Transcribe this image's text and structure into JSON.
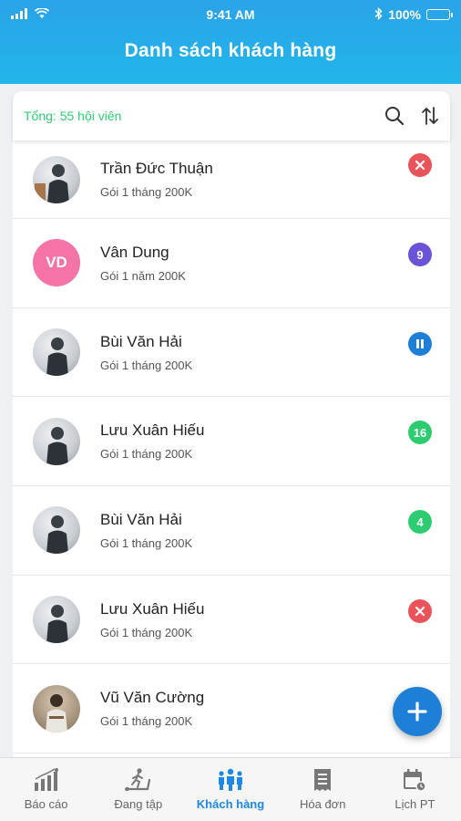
{
  "status_bar": {
    "time": "9:41 AM",
    "battery": "100%"
  },
  "header": {
    "title": "Danh sách khách hàng"
  },
  "summary": {
    "total_text": "Tổng: 55 hội viên"
  },
  "customers": [
    {
      "name": "Trần Đức Thuận",
      "plan": "Gói 1 tháng 200K",
      "avatar": "photo",
      "badge": {
        "type": "x-icon",
        "text": "",
        "color": "#e9545a"
      }
    },
    {
      "name": "Vân Dung",
      "plan": "Gói 1 năm 200K",
      "avatar": "initials",
      "initials": "VD",
      "badge": {
        "type": "number",
        "text": "9",
        "color": "#6b52d6"
      }
    },
    {
      "name": "Bùi Văn Hải",
      "plan": "Gói 1 tháng 200K",
      "avatar": "photo",
      "badge": {
        "type": "pause-icon",
        "text": "",
        "color": "#1e7fd6"
      }
    },
    {
      "name": "Lưu Xuân Hiếu",
      "plan": "Gói 1 tháng 200K",
      "avatar": "photo",
      "badge": {
        "type": "number",
        "text": "16",
        "color": "#2ecc71"
      }
    },
    {
      "name": "Bùi Văn Hải",
      "plan": "Gói 1 tháng 200K",
      "avatar": "photo",
      "badge": {
        "type": "number",
        "text": "4",
        "color": "#2ecc71"
      }
    },
    {
      "name": "Lưu Xuân Hiếu",
      "plan": "Gói 1 tháng 200K",
      "avatar": "photo",
      "badge": {
        "type": "x-icon",
        "text": "",
        "color": "#e9545a"
      }
    },
    {
      "name": "Vũ Văn Cường",
      "plan": "Gói 1 tháng 200K",
      "avatar": "photo",
      "badge": null
    }
  ],
  "tabs": [
    {
      "label": "Báo cáo",
      "icon": "chart-icon",
      "active": false
    },
    {
      "label": "Đang tập",
      "icon": "treadmill-icon",
      "active": false
    },
    {
      "label": "Khách hàng",
      "icon": "people-icon",
      "active": true
    },
    {
      "label": "Hóa đơn",
      "icon": "receipt-icon",
      "active": false
    },
    {
      "label": "Lịch PT",
      "icon": "calendar-icon",
      "active": false
    }
  ],
  "colors": {
    "accent": "#1e88e5",
    "header": "#22b6ea",
    "green": "#2ecc71",
    "red": "#e9545a",
    "purple": "#6b52d6"
  }
}
